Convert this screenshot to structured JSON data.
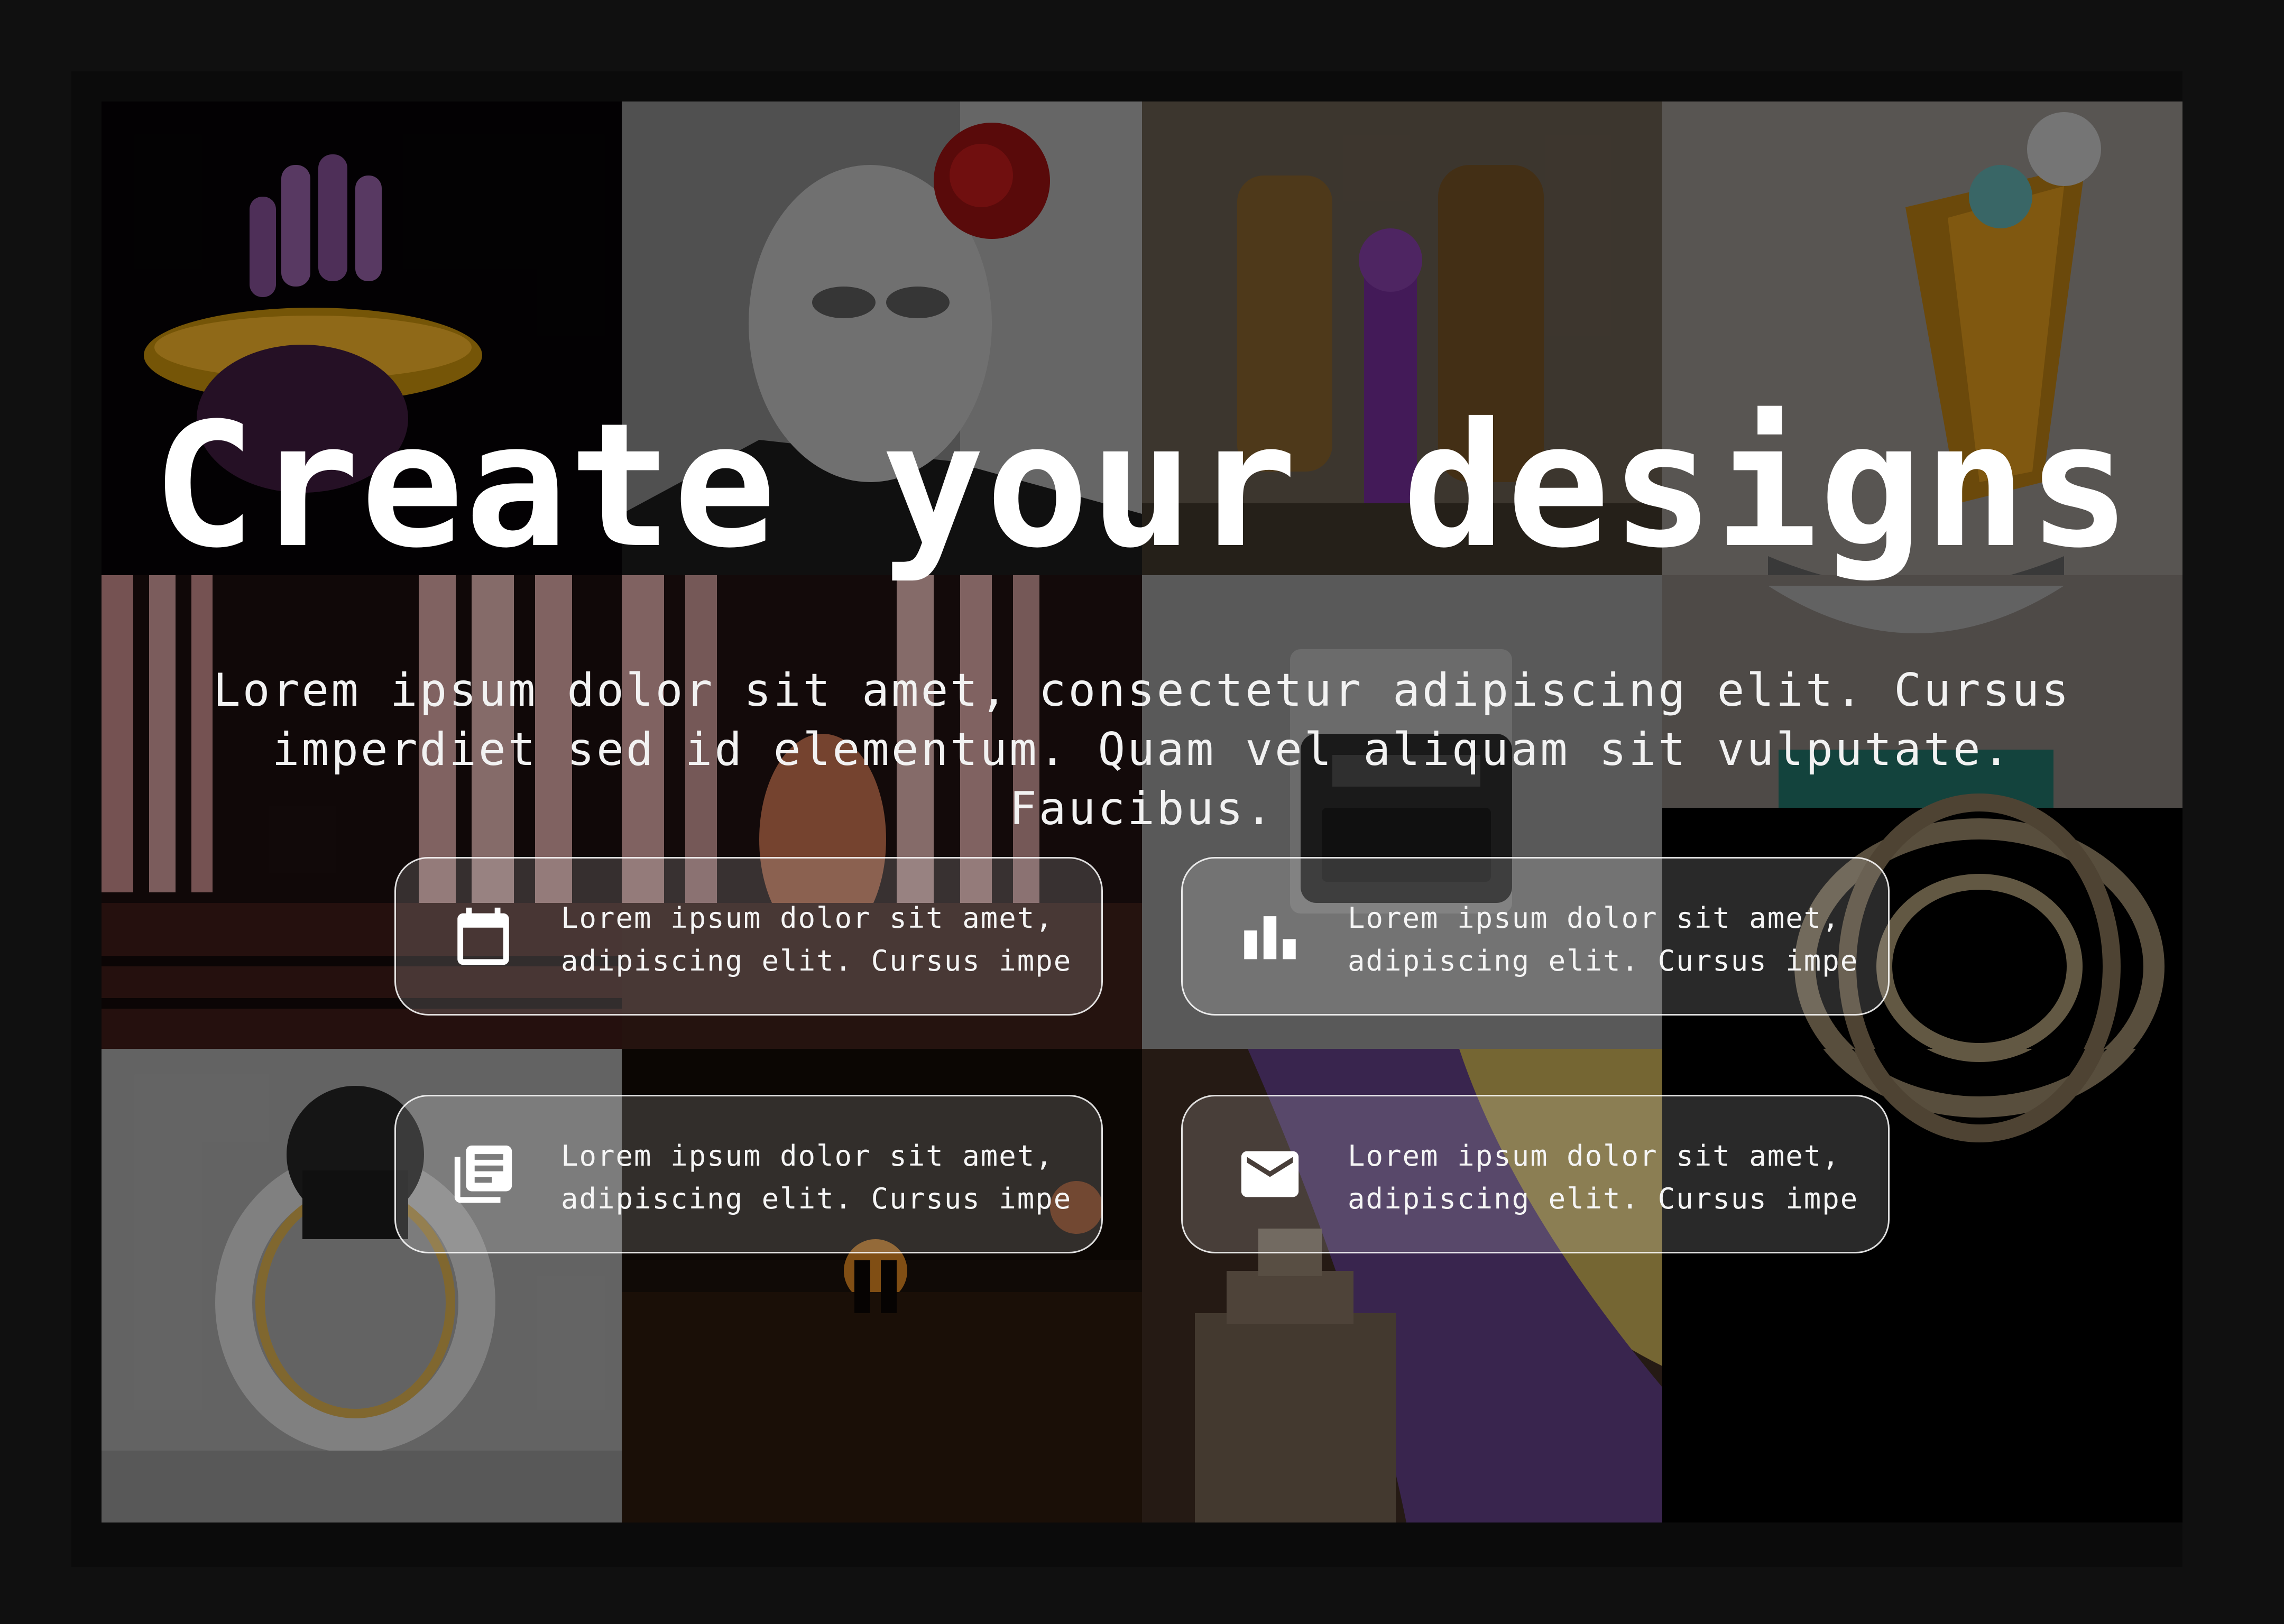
{
  "hero": {
    "title": "Create your designs",
    "subtitle_line1": "Lorem ipsum dolor sit amet, consectetur adipiscing elit. Cursus",
    "subtitle_line2": "imperdiet sed id elementum. Quam vel aliquam sit vulputate. Faucibus."
  },
  "features": [
    {
      "icon": "calendar-icon",
      "line1": "Lorem ipsum dolor sit amet,",
      "line2": "adipiscing elit. Cursus impe"
    },
    {
      "icon": "bar-chart-icon",
      "line1": "Lorem ipsum dolor sit amet,",
      "line2": "adipiscing elit. Cursus impe"
    },
    {
      "icon": "newspaper-icon",
      "line1": "Lorem ipsum dolor sit amet,",
      "line2": "adipiscing elit. Cursus impe"
    },
    {
      "icon": "mail-icon",
      "line1": "Lorem ipsum dolor sit amet,",
      "line2": "adipiscing elit. Cursus impe"
    }
  ],
  "colors": {
    "background": "#101010",
    "text": "#ffffff",
    "card_border": "#ffffff"
  }
}
